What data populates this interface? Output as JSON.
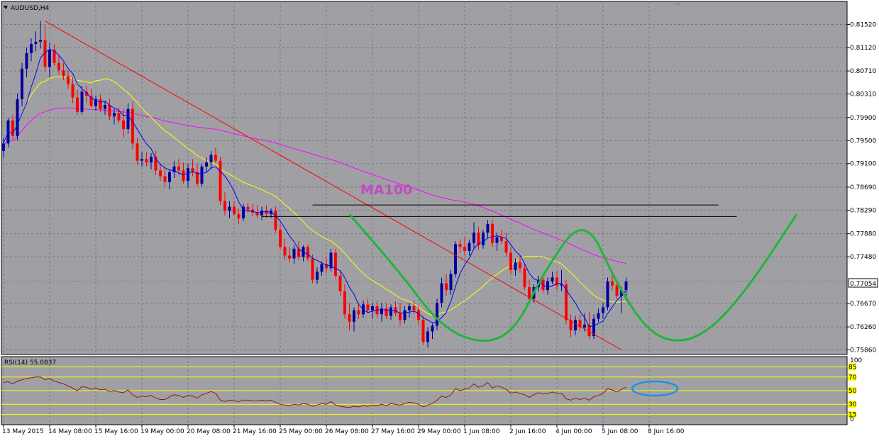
{
  "symbol_label": "AUDUSD,H4",
  "chart_data": [
    {
      "type": "candlestick",
      "title": "AUDUSD,H4",
      "y_ticks": [
        0.8152,
        0.8112,
        0.8071,
        0.8031,
        0.799,
        0.795,
        0.791,
        0.7869,
        0.7829,
        0.7788,
        0.7748,
        0.7667,
        0.7626,
        0.7586
      ],
      "y_tick_labels": [
        "0.81520",
        "0.81120",
        "0.80710",
        "0.80310",
        "0.79900",
        "0.79500",
        "0.79100",
        "0.78690",
        "0.78290",
        "0.77880",
        "0.77480",
        "0.76670",
        "0.76260",
        "0.75860"
      ],
      "ylim": [
        0.7578,
        0.8192
      ],
      "current_price": 0.77054,
      "current_price_label": "0.77054",
      "x_tick_labels": [
        "13 May 2015",
        "14 May 08:00",
        "15 May 16:00",
        "19 May 00:00",
        "20 May 08:00",
        "21 May 16:00",
        "25 May 00:00",
        "26 May 08:00",
        "27 May 16:00",
        "29 May 00:00",
        "1 Jun 08:00",
        "2 Jun 16:00",
        "4 Jun 00:00",
        "5 Jun 08:00",
        "8 Jun 16:00"
      ],
      "grid": true,
      "annotation_text": "MA100",
      "colors": {
        "background": "#a0a0a4",
        "bull": "#0000a0",
        "bear": "#ff0000",
        "ma_fast": "#0000ff",
        "ma_slow": "#ffff00",
        "ma100": "#ff00ff",
        "trendline": "#ff0000",
        "pattern": "#21b53a",
        "levels": "#000000",
        "grid": "#6f7a88"
      },
      "candles": [
        [
          0.7932,
          0.7955,
          0.792,
          0.7945
        ],
        [
          0.7945,
          0.799,
          0.7938,
          0.7985
        ],
        [
          0.7985,
          0.7995,
          0.7952,
          0.7958
        ],
        [
          0.7958,
          0.8032,
          0.795,
          0.8022
        ],
        [
          0.8022,
          0.8085,
          0.801,
          0.8075
        ],
        [
          0.8075,
          0.8112,
          0.806,
          0.8102
        ],
        [
          0.8102,
          0.8128,
          0.8088,
          0.8118
        ],
        [
          0.8118,
          0.814,
          0.8105,
          0.8122
        ],
        [
          0.8122,
          0.8158,
          0.811,
          0.8125
        ],
        [
          0.8125,
          0.815,
          0.807,
          0.8078
        ],
        [
          0.8078,
          0.812,
          0.806,
          0.8108
        ],
        [
          0.8108,
          0.8118,
          0.808,
          0.8085
        ],
        [
          0.8085,
          0.8098,
          0.8065,
          0.8072
        ],
        [
          0.8072,
          0.8085,
          0.8055,
          0.8062
        ],
        [
          0.8062,
          0.8072,
          0.804,
          0.8048
        ],
        [
          0.8048,
          0.806,
          0.8015,
          0.8025
        ],
        [
          0.8025,
          0.8038,
          0.7995,
          0.8
        ],
        [
          0.8,
          0.8045,
          0.7995,
          0.8035
        ],
        [
          0.8035,
          0.8045,
          0.8015,
          0.8028
        ],
        [
          0.8028,
          0.804,
          0.8008,
          0.801
        ],
        [
          0.801,
          0.8028,
          0.8002,
          0.8022
        ],
        [
          0.8022,
          0.803,
          0.8,
          0.8005
        ],
        [
          0.8005,
          0.8018,
          0.7995,
          0.8012
        ],
        [
          0.8012,
          0.8022,
          0.7985,
          0.7992
        ],
        [
          0.7992,
          0.8005,
          0.7978,
          0.7998
        ],
        [
          0.7998,
          0.8008,
          0.798,
          0.7985
        ],
        [
          0.7985,
          0.8005,
          0.7955,
          0.797
        ],
        [
          0.797,
          0.8015,
          0.7962,
          0.8005
        ],
        [
          0.8005,
          0.8018,
          0.7935,
          0.7945
        ],
        [
          0.7945,
          0.7955,
          0.7908,
          0.7915
        ],
        [
          0.7915,
          0.793,
          0.7905,
          0.7918
        ],
        [
          0.7918,
          0.793,
          0.7905,
          0.7912
        ],
        [
          0.7912,
          0.7928,
          0.79,
          0.7922
        ],
        [
          0.7922,
          0.7932,
          0.789,
          0.7898
        ],
        [
          0.7898,
          0.791,
          0.788,
          0.7888
        ],
        [
          0.7888,
          0.7905,
          0.787,
          0.7878
        ],
        [
          0.7878,
          0.79,
          0.7865,
          0.7895
        ],
        [
          0.7895,
          0.7915,
          0.7885,
          0.7905
        ],
        [
          0.7905,
          0.7918,
          0.789,
          0.7898
        ],
        [
          0.7898,
          0.7912,
          0.7875,
          0.788
        ],
        [
          0.788,
          0.791,
          0.7868,
          0.7902
        ],
        [
          0.7902,
          0.7918,
          0.7888,
          0.7895
        ],
        [
          0.7895,
          0.791,
          0.787,
          0.7875
        ],
        [
          0.7875,
          0.791,
          0.787,
          0.7905
        ],
        [
          0.7905,
          0.792,
          0.7895,
          0.7912
        ],
        [
          0.7912,
          0.7932,
          0.79,
          0.7925
        ],
        [
          0.7925,
          0.7938,
          0.791,
          0.7915
        ],
        [
          0.7915,
          0.7922,
          0.7838,
          0.7845
        ],
        [
          0.7845,
          0.786,
          0.782,
          0.7828
        ],
        [
          0.7828,
          0.7845,
          0.7815,
          0.7835
        ],
        [
          0.7835,
          0.7845,
          0.7818,
          0.7822
        ],
        [
          0.7822,
          0.7832,
          0.7805,
          0.7815
        ],
        [
          0.7815,
          0.784,
          0.781,
          0.7835
        ],
        [
          0.7835,
          0.7842,
          0.7825,
          0.783
        ],
        [
          0.783,
          0.784,
          0.7818,
          0.7825
        ],
        [
          0.7825,
          0.7838,
          0.7815,
          0.782
        ],
        [
          0.782,
          0.7835,
          0.7812,
          0.7828
        ],
        [
          0.7828,
          0.7838,
          0.7815,
          0.7822
        ],
        [
          0.7822,
          0.7832,
          0.7815,
          0.7828
        ],
        [
          0.7828,
          0.7835,
          0.779,
          0.7795
        ],
        [
          0.7795,
          0.7805,
          0.776,
          0.7765
        ],
        [
          0.7765,
          0.778,
          0.7742,
          0.775
        ],
        [
          0.775,
          0.7765,
          0.7738,
          0.7745
        ],
        [
          0.7745,
          0.7768,
          0.7735,
          0.7762
        ],
        [
          0.7762,
          0.7775,
          0.7742,
          0.7748
        ],
        [
          0.7748,
          0.7768,
          0.774,
          0.7765
        ],
        [
          0.7765,
          0.777,
          0.774,
          0.7745
        ],
        [
          0.7745,
          0.7752,
          0.7702,
          0.7708
        ],
        [
          0.7708,
          0.773,
          0.77,
          0.7722
        ],
        [
          0.7722,
          0.774,
          0.7715,
          0.7735
        ],
        [
          0.7735,
          0.7748,
          0.772,
          0.7728
        ],
        [
          0.7728,
          0.7762,
          0.7722,
          0.7755
        ],
        [
          0.7755,
          0.7762,
          0.771,
          0.7715
        ],
        [
          0.7715,
          0.7722,
          0.768,
          0.7688
        ],
        [
          0.7688,
          0.77,
          0.764,
          0.7648
        ],
        [
          0.7648,
          0.7668,
          0.762,
          0.7635
        ],
        [
          0.7635,
          0.766,
          0.7618,
          0.7655
        ],
        [
          0.7655,
          0.7668,
          0.764,
          0.7648
        ],
        [
          0.7648,
          0.7672,
          0.7642,
          0.7665
        ],
        [
          0.7665,
          0.7675,
          0.765,
          0.7655
        ],
        [
          0.7655,
          0.7668,
          0.764,
          0.7662
        ],
        [
          0.7662,
          0.7672,
          0.7642,
          0.7648
        ],
        [
          0.7648,
          0.7668,
          0.7635,
          0.7658
        ],
        [
          0.7658,
          0.7668,
          0.764,
          0.7645
        ],
        [
          0.7645,
          0.7665,
          0.7638,
          0.766
        ],
        [
          0.766,
          0.767,
          0.7645,
          0.765
        ],
        [
          0.765,
          0.7668,
          0.7628,
          0.7638
        ],
        [
          0.7638,
          0.7662,
          0.7632,
          0.7655
        ],
        [
          0.7655,
          0.7668,
          0.7642,
          0.7662
        ],
        [
          0.7662,
          0.7672,
          0.7648,
          0.7655
        ],
        [
          0.7655,
          0.7662,
          0.763,
          0.7638
        ],
        [
          0.7638,
          0.7645,
          0.7595,
          0.76
        ],
        [
          0.76,
          0.7625,
          0.759,
          0.7618
        ],
        [
          0.7618,
          0.7632,
          0.7605,
          0.7628
        ],
        [
          0.7628,
          0.7675,
          0.762,
          0.7668
        ],
        [
          0.7668,
          0.7712,
          0.766,
          0.7702
        ],
        [
          0.7702,
          0.7718,
          0.768,
          0.769
        ],
        [
          0.769,
          0.7725,
          0.7682,
          0.7718
        ],
        [
          0.7718,
          0.7775,
          0.7712,
          0.777
        ],
        [
          0.777,
          0.7778,
          0.7755,
          0.7765
        ],
        [
          0.7765,
          0.7782,
          0.775,
          0.7758
        ],
        [
          0.7758,
          0.7778,
          0.775,
          0.7772
        ],
        [
          0.7772,
          0.7808,
          0.776,
          0.779
        ],
        [
          0.779,
          0.78,
          0.776,
          0.7768
        ],
        [
          0.7768,
          0.7795,
          0.7762,
          0.779
        ],
        [
          0.779,
          0.7812,
          0.778,
          0.7805
        ],
        [
          0.7805,
          0.7812,
          0.7765,
          0.7772
        ],
        [
          0.7772,
          0.779,
          0.7758,
          0.7782
        ],
        [
          0.7782,
          0.7795,
          0.777,
          0.7775
        ],
        [
          0.7775,
          0.779,
          0.7748,
          0.7755
        ],
        [
          0.7755,
          0.7765,
          0.7718,
          0.7725
        ],
        [
          0.7725,
          0.7745,
          0.7715,
          0.7738
        ],
        [
          0.7738,
          0.775,
          0.772,
          0.7728
        ],
        [
          0.7728,
          0.7735,
          0.769,
          0.7695
        ],
        [
          0.7695,
          0.7708,
          0.7668,
          0.7675
        ],
        [
          0.7675,
          0.77,
          0.7668,
          0.7695
        ],
        [
          0.7695,
          0.7715,
          0.7688,
          0.7708
        ],
        [
          0.7708,
          0.7718,
          0.7685,
          0.769
        ],
        [
          0.769,
          0.7712,
          0.7682,
          0.7705
        ],
        [
          0.7705,
          0.7722,
          0.77,
          0.7712
        ],
        [
          0.7712,
          0.7722,
          0.769,
          0.7698
        ],
        [
          0.7698,
          0.7725,
          0.7688,
          0.77
        ],
        [
          0.77,
          0.7708,
          0.763,
          0.7638
        ],
        [
          0.7638,
          0.7648,
          0.7608,
          0.762
        ],
        [
          0.762,
          0.7645,
          0.7612,
          0.7638
        ],
        [
          0.7638,
          0.7648,
          0.7618,
          0.7625
        ],
        [
          0.7625,
          0.765,
          0.7618,
          0.763
        ],
        [
          0.763,
          0.7652,
          0.7605,
          0.761
        ],
        [
          0.761,
          0.7648,
          0.7605,
          0.764
        ],
        [
          0.764,
          0.7658,
          0.7635,
          0.765
        ],
        [
          0.765,
          0.7668,
          0.764,
          0.766
        ],
        [
          0.766,
          0.7712,
          0.7655,
          0.7705
        ],
        [
          0.7705,
          0.7722,
          0.769,
          0.7698
        ],
        [
          0.7698,
          0.7705,
          0.7675,
          0.768
        ],
        [
          0.768,
          0.7695,
          0.765,
          0.769
        ],
        [
          0.769,
          0.7712,
          0.7672,
          0.7705
        ]
      ],
      "trendline": {
        "from": {
          "bar": 9,
          "price": 0.8158
        },
        "to": {
          "bar": 134,
          "price": 0.7586
        }
      },
      "horizontal_levels": [
        0.7838,
        0.7818
      ],
      "double_bottom": {
        "path": [
          [
            75,
            0.7822
          ],
          [
            86,
            0.772
          ],
          [
            95,
            0.7625
          ],
          [
            104,
            0.7595
          ],
          [
            111,
            0.762
          ],
          [
            117,
            0.772
          ],
          [
            126,
            0.7822
          ],
          [
            133,
            0.77
          ],
          [
            140,
            0.7615
          ],
          [
            147,
            0.7597
          ],
          [
            154,
            0.7625
          ],
          [
            162,
            0.77
          ],
          [
            172,
            0.7822
          ]
        ]
      }
    },
    {
      "type": "line",
      "title": "RSI(14) 55.0837",
      "ylim": [
        0,
        100
      ],
      "y_tick_labels": [
        "100",
        "0"
      ],
      "levels": [
        85,
        70,
        50,
        30,
        15
      ],
      "level_labels": [
        "85",
        "70",
        "50",
        "30",
        "15"
      ],
      "values": [
        62,
        63,
        60,
        64,
        66,
        68,
        69,
        70,
        70,
        66,
        68,
        64,
        62,
        60,
        57,
        54,
        50,
        56,
        55,
        52,
        54,
        51,
        52,
        49,
        50,
        48,
        47,
        51,
        44,
        40,
        42,
        41,
        43,
        39,
        37,
        37,
        41,
        44,
        43,
        40,
        43,
        42,
        39,
        44,
        46,
        49,
        46,
        36,
        34,
        36,
        35,
        34,
        36,
        36,
        35,
        35,
        36,
        35,
        36,
        33,
        30,
        29,
        28,
        30,
        29,
        31,
        30,
        27,
        29,
        31,
        30,
        34,
        29,
        27,
        26,
        25,
        27,
        26,
        28,
        27,
        29,
        28,
        30,
        28,
        31,
        30,
        29,
        31,
        33,
        32,
        30,
        26,
        29,
        31,
        36,
        42,
        40,
        44,
        53,
        50,
        52,
        54,
        60,
        55,
        57,
        62,
        54,
        57,
        55,
        52,
        46,
        48,
        46,
        44,
        40,
        44,
        47,
        45,
        46,
        48,
        46,
        46,
        38,
        36,
        39,
        37,
        39,
        36,
        41,
        43,
        46,
        53,
        51,
        48,
        52,
        55
      ],
      "annotation": "ellipse around latest RSI readings"
    }
  ]
}
